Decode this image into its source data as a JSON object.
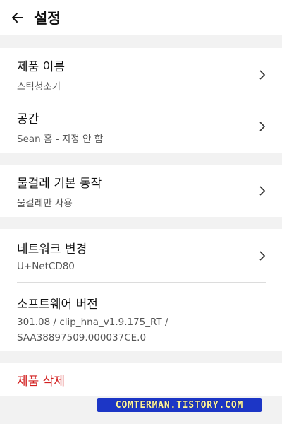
{
  "header": {
    "title": "설정",
    "back_icon": "arrow-left-icon"
  },
  "sections": {
    "product": {
      "name_label": "제품 이름",
      "name_value": "스틱청소기",
      "space_label": "공간",
      "space_value": "Sean 홈 - 지정 안 함"
    },
    "mop": {
      "label": "물걸레 기본 동작",
      "value": "물걸레만 사용"
    },
    "network": {
      "net_label": "네트워크 변경",
      "net_value": "U+NetCD80",
      "sw_label": "소프트웨어 버전",
      "sw_value_line1": "301.08 / clip_hna_v1.9.175_RT /",
      "sw_value_line2": "SAA38897509.000037CE.0"
    },
    "delete": {
      "label": "제품 삭제"
    }
  },
  "watermark": "COMTERMAN.TISTORY.COM",
  "colors": {
    "danger": "#d21f1f",
    "background": "#f2f2f2",
    "watermark_bg": "#1c36c6",
    "watermark_fg": "#fff5a0"
  }
}
